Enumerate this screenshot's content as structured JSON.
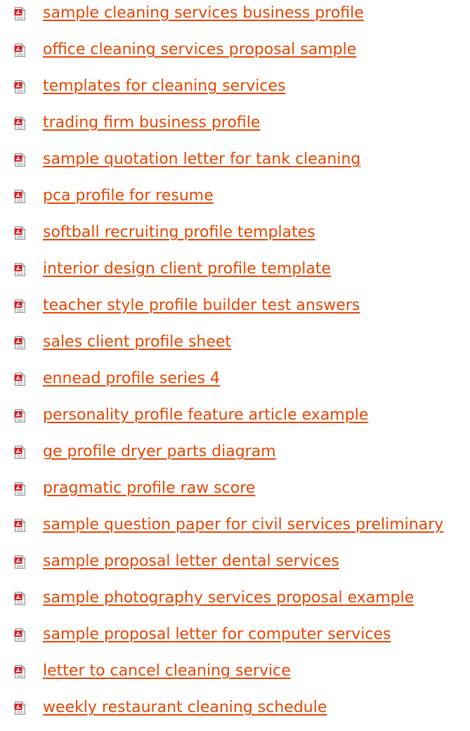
{
  "colors": {
    "link": "#e84500",
    "icon_red": "#d41e1e",
    "icon_paper": "#f4f4f4",
    "icon_border": "#8a8a8a"
  },
  "icon": "pdf-file-icon",
  "links": [
    {
      "label": "sample cleaning services business profile"
    },
    {
      "label": "office cleaning services proposal sample"
    },
    {
      "label": "templates for cleaning services"
    },
    {
      "label": "trading firm business profile"
    },
    {
      "label": "sample quotation letter for tank cleaning"
    },
    {
      "label": "pca profile for resume"
    },
    {
      "label": "softball recruiting profile templates"
    },
    {
      "label": "interior design client profile template"
    },
    {
      "label": "teacher style profile builder test answers"
    },
    {
      "label": "sales client profile sheet"
    },
    {
      "label": "ennead profile series 4"
    },
    {
      "label": "personality profile feature article example"
    },
    {
      "label": "ge profile dryer parts diagram"
    },
    {
      "label": "pragmatic profile raw score"
    },
    {
      "label": "sample question paper for civil services preliminary"
    },
    {
      "label": "sample proposal letter dental services"
    },
    {
      "label": "sample photography services proposal example"
    },
    {
      "label": "sample proposal letter for computer services"
    },
    {
      "label": "letter to cancel cleaning service"
    },
    {
      "label": "weekly restaurant cleaning schedule"
    }
  ]
}
